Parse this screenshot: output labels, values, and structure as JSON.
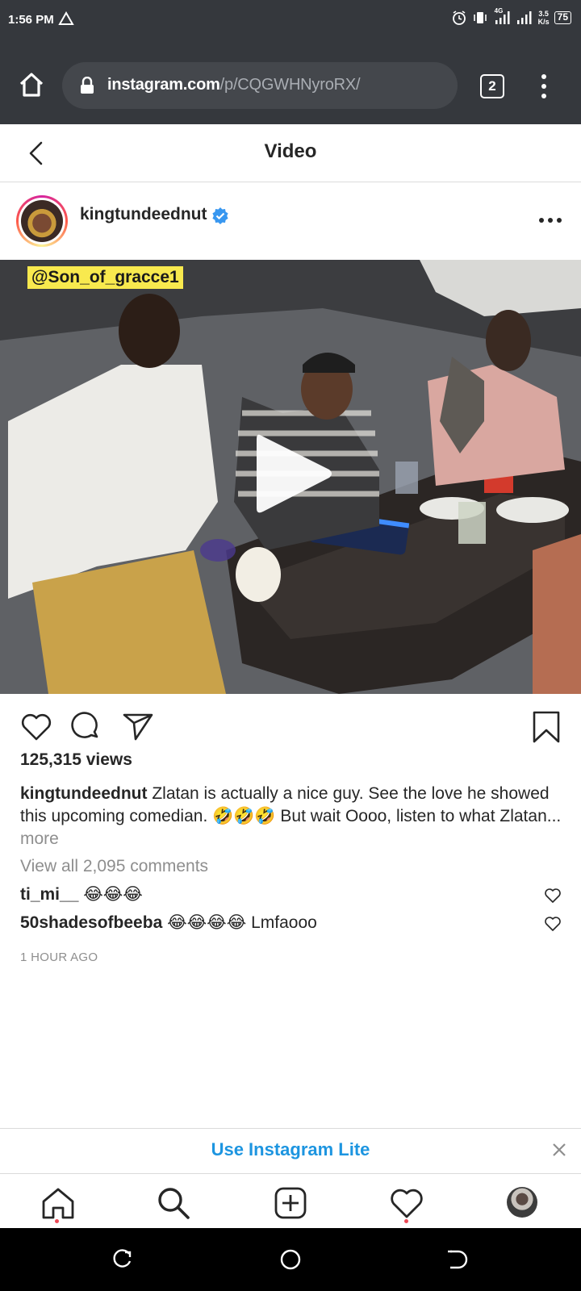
{
  "status_bar": {
    "time": "1:56 PM",
    "network_type": "4G",
    "speed_value": "3.5",
    "speed_unit": "K/s",
    "battery": "75"
  },
  "browser": {
    "url_domain": "instagram.com",
    "url_path": "/p/CQGWHNyroRX/",
    "tab_count": "2"
  },
  "header": {
    "title": "Video"
  },
  "post": {
    "username": "kingtundeednut",
    "verified": true,
    "video_overlay_tag": "@Son_of_gracce1",
    "views": "125,315 views",
    "caption_username": "kingtundeednut",
    "caption_text": "Zlatan is actually a nice guy. See the love he showed this upcoming comedian. 🤣🤣🤣 But wait Oooo, listen to what Zlatan...",
    "caption_more": "more",
    "view_all_comments": "View all 2,095 comments",
    "comments": [
      {
        "username": "ti_mi__",
        "text": "😂😂😂"
      },
      {
        "username": "50shadesofbeeba",
        "text": "😂😂😂😂 Lmfaooo"
      }
    ],
    "time_ago": "1 HOUR AGO"
  },
  "lite_banner": {
    "label": "Use Instagram Lite"
  },
  "colors": {
    "chrome_bar": "#35383d",
    "link_blue": "#1d95e0",
    "verified_blue": "#3897f0",
    "notification_red": "#ed4956",
    "overlay_yellow": "#f8e94e"
  }
}
